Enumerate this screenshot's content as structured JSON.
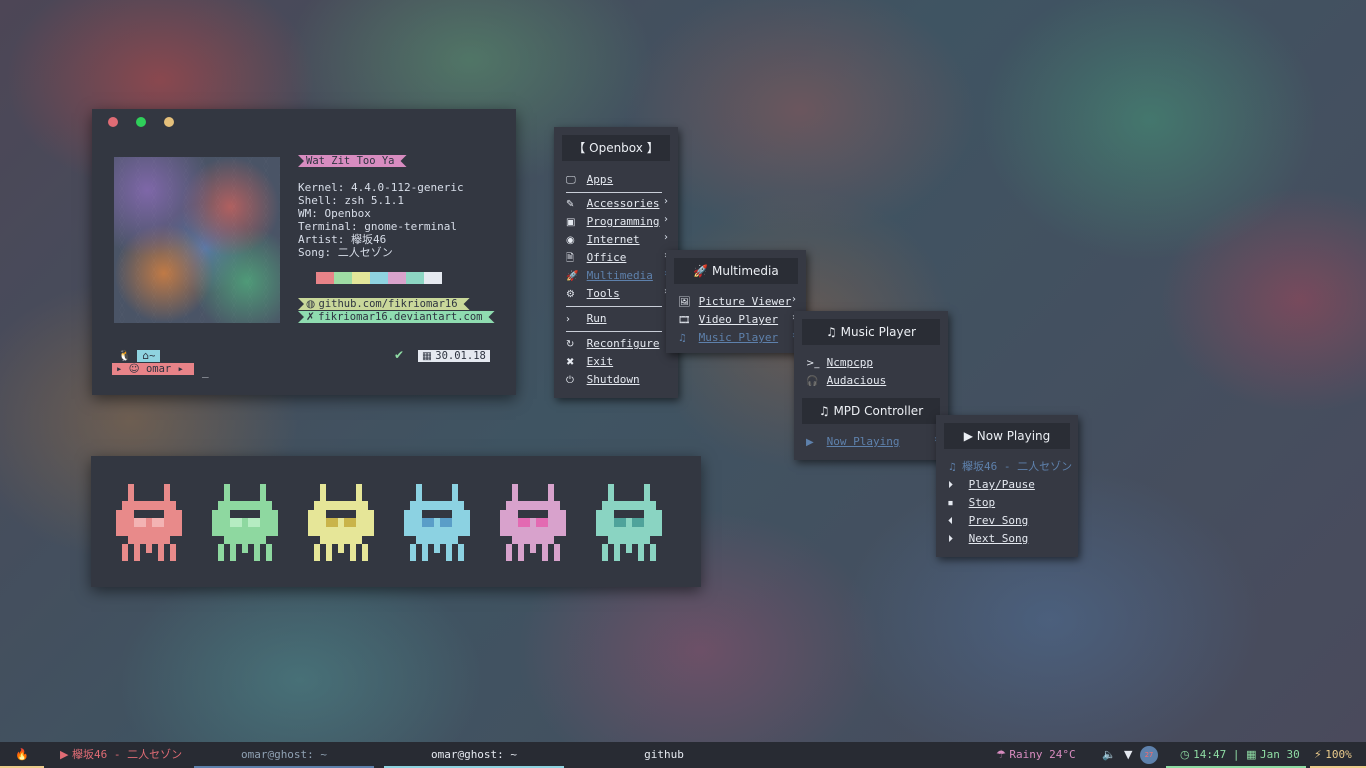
{
  "terminal": {
    "song_title": "Wat Zit Too Ya",
    "info": [
      {
        "key": "Kernel:",
        "value": " 4.4.0-112-generic"
      },
      {
        "key": "Shell:",
        "value": " zsh 5.1.1"
      },
      {
        "key": "WM:",
        "value": " Openbox"
      },
      {
        "key": "Terminal:",
        "value": " gnome-terminal"
      },
      {
        "key": "Artist:",
        "value": " 欅坂46"
      },
      {
        "key": "Song:",
        "value": " 二人セゾン"
      }
    ],
    "swatch_colors": [
      "#e88388",
      "#9fdca4",
      "#e3e69a",
      "#8fd3e0",
      "#d9a3cc",
      "#8dd6c3",
      "#e5e9f0"
    ],
    "github": "github.com/fikriomar16",
    "deviantart": "fikriomar16.deviantart.com",
    "prompt_dir": "~",
    "prompt_user": "omar",
    "cursor": "_",
    "date": "30.01.18",
    "dot_colors": [
      "#e06c75",
      "#2fcf5a",
      "#e5c07b"
    ]
  },
  "invaders": {
    "colors": [
      "#e88a8a",
      "#8ed8a0",
      "#e6e698",
      "#8cd2e2",
      "#d8a2cc",
      "#8ad4c2"
    ],
    "eye_colors": [
      "#f3b3b3",
      "#b5ecc2",
      "#c9b44a",
      "#5a9ec8",
      "#e36ab2",
      "#4fa39b"
    ]
  },
  "menu_root": {
    "title": "Openbox",
    "items": [
      {
        "glyph": "🖵",
        "label": "Apps"
      },
      {
        "glyph": "✎",
        "label": "Accessories",
        "arrow": "›"
      },
      {
        "glyph": "▣",
        "label": "Programming",
        "arrow": "›"
      },
      {
        "glyph": "◉",
        "label": "Internet",
        "arrow": "›"
      },
      {
        "glyph": "🗎",
        "label": "Office",
        "arrow": "›"
      },
      {
        "glyph": "🚀",
        "label": "Multimedia",
        "arrow": "›"
      },
      {
        "glyph": "⚙",
        "label": "Tools",
        "arrow": "›"
      },
      {
        "glyph": "›",
        "label": "Run"
      },
      {
        "glyph": "↻",
        "label": "Reconfigure"
      },
      {
        "glyph": "✖",
        "label": "Exit"
      },
      {
        "glyph": "⏻",
        "label": "Shutdown"
      }
    ]
  },
  "menu_multimedia": {
    "title": "Multimedia",
    "items": [
      {
        "glyph": "🖼",
        "label": "Picture Viewer",
        "arrow": "›"
      },
      {
        "glyph": "🎞",
        "label": "Video Player",
        "arrow": "›"
      },
      {
        "glyph": "♫",
        "label": "Music Player",
        "arrow": "›"
      }
    ]
  },
  "menu_music": {
    "title": "Music Player",
    "items": [
      {
        "glyph": ">_",
        "label": "Ncmpcpp"
      },
      {
        "glyph": "🎧",
        "label": "Audacious"
      }
    ],
    "sub_title": "MPD Controller",
    "now_playing": {
      "glyph": "▶",
      "label": "Now Playing",
      "arrow": "›"
    }
  },
  "menu_now_playing": {
    "title": "Now Playing",
    "track": "欅坂46 - 二人セゾン",
    "items": [
      {
        "glyph": "⏵",
        "label": "Play/Pause"
      },
      {
        "glyph": "⏹",
        "label": "Stop"
      },
      {
        "glyph": "⏴",
        "label": "Prev Song"
      },
      {
        "glyph": "⏵",
        "label": "Next Song"
      }
    ]
  },
  "taskbar": {
    "launcher_glyph": "🔥",
    "now_playing": "欅坂46 - 二人セゾン",
    "tasks": [
      "omar@ghost: ~",
      "omar@ghost: ~",
      "github"
    ],
    "weather": "Rainy 24°C",
    "notif_count": "27",
    "time": "14:47",
    "date": "Jan 30",
    "battery": "100%"
  }
}
